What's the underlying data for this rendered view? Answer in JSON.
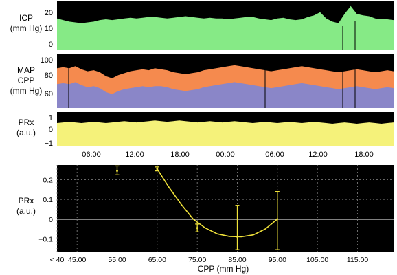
{
  "chart_data": [
    {
      "type": "area",
      "ylabel_lines": [
        "ICP",
        "(mm Hg)"
      ],
      "yticks": [
        "20",
        "10",
        "0"
      ],
      "ylim": [
        -3,
        28
      ],
      "series": [
        {
          "color": "#86ea86",
          "values": [
            17,
            16,
            15,
            14.5,
            14,
            14.5,
            15,
            16,
            16.5,
            16,
            16.5,
            17,
            17.5,
            17,
            17.5,
            18,
            18,
            17.5,
            17,
            17.5,
            18,
            18.5,
            18,
            17.5,
            17,
            17.5,
            17,
            17,
            16.5,
            17,
            17.5,
            18,
            18,
            17,
            16.5,
            16,
            17,
            17.5,
            16.5,
            16,
            16.5,
            18,
            19,
            21,
            17,
            15,
            14,
            20,
            25,
            20,
            19,
            18.5,
            17,
            16.5,
            16.5,
            16
          ]
        }
      ]
    },
    {
      "type": "area",
      "ylabel_lines": [
        "MAP",
        "CPP",
        "(mm Hg)"
      ],
      "yticks": [
        "100",
        "80",
        "60"
      ],
      "ylim": [
        48,
        102
      ],
      "series": [
        {
          "name": "MAP",
          "color": "#f58a4e",
          "values": [
            88,
            89,
            88,
            90,
            87,
            85,
            86,
            84,
            80,
            78,
            81,
            83,
            85,
            86,
            87,
            86,
            88,
            87,
            86,
            84,
            83,
            82,
            83,
            84,
            86,
            87,
            88,
            89,
            90,
            91,
            90,
            89,
            88,
            87,
            86,
            85,
            86,
            87,
            88,
            89,
            90,
            89,
            88,
            87,
            86,
            85,
            84,
            85,
            86,
            87,
            86,
            85,
            84,
            85,
            86,
            85
          ]
        },
        {
          "name": "CPP",
          "color": "#8a86c8",
          "values": [
            72,
            73,
            72,
            74,
            71,
            69,
            70,
            68,
            64,
            62,
            65,
            67,
            68,
            69,
            70,
            69,
            70,
            70,
            69,
            67,
            66,
            65,
            66,
            67,
            69,
            70,
            71,
            72,
            73,
            74,
            73,
            72,
            71,
            70,
            69,
            68,
            69,
            70,
            71,
            72,
            73,
            72,
            71,
            70,
            69,
            68,
            67,
            68,
            69,
            70,
            69,
            68,
            67,
            68,
            69,
            68
          ]
        }
      ]
    },
    {
      "type": "area",
      "ylabel_lines": [
        "PRx",
        "(a.u.)"
      ],
      "yticks": [
        "1",
        "0",
        "−1"
      ],
      "ylim": [
        -1.3,
        1.3
      ],
      "xticks": [
        "06:00",
        "12:00",
        "18:00",
        "00:00",
        "06:00",
        "12:00",
        "18:00"
      ],
      "series": [
        {
          "color": "#f5f27a",
          "values": [
            0.45,
            0.5,
            0.55,
            0.5,
            0.45,
            0.5,
            0.55,
            0.5,
            0.45,
            0.5,
            0.55,
            0.6,
            0.55,
            0.5,
            0.55,
            0.6,
            0.65,
            0.6,
            0.55,
            0.6,
            0.65,
            0.6,
            0.55,
            0.5,
            0.55,
            0.6,
            0.55,
            0.5,
            0.55,
            0.6,
            0.55,
            0.5,
            0.45,
            0.5,
            0.55,
            0.5,
            0.45,
            0.5,
            0.55,
            0.5,
            0.45,
            0.5,
            0.55,
            0.5,
            0.45,
            0.4,
            0.45,
            0.5,
            0.45,
            0.4,
            0.45,
            0.5,
            0.45,
            0.4,
            0.45,
            0.5
          ]
        }
      ]
    },
    {
      "type": "line",
      "ylabel_lines": [
        "PRx",
        "(a.u.)"
      ],
      "xlabel": "CPP (mm Hg)",
      "xticks": [
        "< 40",
        "45.00",
        "55.00",
        "65.00",
        "75.00",
        "85.00",
        "95.00",
        "105.00",
        "115.00"
      ],
      "xtick_values": [
        40,
        45,
        55,
        65,
        75,
        85,
        95,
        105,
        115
      ],
      "xlim": [
        40,
        124
      ],
      "yticks": [
        0.2,
        0.1,
        0,
        -0.1
      ],
      "ylim": [
        -0.165,
        0.275
      ],
      "grid": true,
      "points": [
        {
          "x": 55,
          "y": 0.245,
          "err_lo": 0.225,
          "err_hi": 0.27
        },
        {
          "x": 65,
          "y": 0.255,
          "err_lo": 0.245,
          "err_hi": 0.265
        },
        {
          "x": 75,
          "y": -0.045,
          "err_lo": -0.065,
          "err_hi": -0.025
        },
        {
          "x": 85,
          "y": -0.09,
          "err_lo": -0.155,
          "err_hi": 0.07
        },
        {
          "x": 95,
          "y": 0.0,
          "err_lo": -0.155,
          "err_hi": 0.14
        }
      ],
      "fit": {
        "x": [
          65,
          68,
          71,
          74,
          77,
          80,
          83,
          86,
          89,
          92,
          95
        ],
        "y": [
          0.255,
          0.16,
          0.075,
          0.0,
          -0.045,
          -0.075,
          -0.088,
          -0.09,
          -0.08,
          -0.05,
          0.0
        ]
      },
      "zero_line": true
    }
  ]
}
